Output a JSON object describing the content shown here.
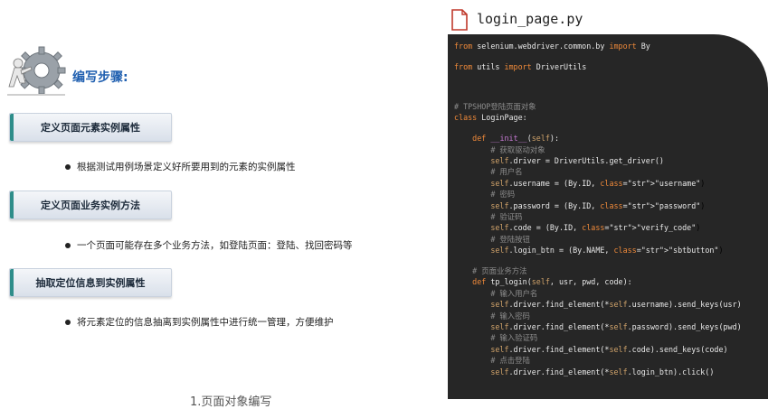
{
  "left": {
    "steps_title": "编写步骤:",
    "sections": [
      {
        "title": "定义页面元素实例属性",
        "bullet": "根据测试用例场景定义好所要用到的元素的实例属性"
      },
      {
        "title": "定义页面业务实例方法",
        "bullet": "一个页面可能存在多个业务方法，如登陆页面：登陆、找回密码等"
      },
      {
        "title": "抽取定位信息到实例属性",
        "bullet": "将元素定位的信息抽离到实例属性中进行统一管理，方便维护"
      }
    ],
    "footer_partial": "1.页面对象编写"
  },
  "file_tab": {
    "filename": "login_page.py",
    "icon": "file-icon"
  },
  "code": {
    "lines": [
      {
        "t": "from selenium.webdriver.common.by import By"
      },
      {
        "t": ""
      },
      {
        "t": "from utils import DriverUtils"
      },
      {
        "t": ""
      },
      {
        "t": ""
      },
      {
        "t": ""
      },
      {
        "t": "# TPSHOP登陆页面对象"
      },
      {
        "t": "class LoginPage:"
      },
      {
        "t": ""
      },
      {
        "t": "    def __init__(self):"
      },
      {
        "t": "        # 获取驱动对象"
      },
      {
        "t": "        self.driver = DriverUtils.get_driver()"
      },
      {
        "t": "        # 用户名"
      },
      {
        "t": "        self.username = (By.ID, \"username\")"
      },
      {
        "t": "        # 密码"
      },
      {
        "t": "        self.password = (By.ID, \"password\")"
      },
      {
        "t": "        # 验证码"
      },
      {
        "t": "        self.code = (By.ID, \"verify_code\")"
      },
      {
        "t": "        # 登陆按钮"
      },
      {
        "t": "        self.login_btn = (By.NAME, \"sbtbutton\")"
      },
      {
        "t": ""
      },
      {
        "t": "    # 页面业务方法"
      },
      {
        "t": "    def tp_login(self, usr, pwd, code):"
      },
      {
        "t": "        # 输入用户名"
      },
      {
        "t": "        self.driver.find_element(*self.username).send_keys(usr)"
      },
      {
        "t": "        # 输入密码"
      },
      {
        "t": "        self.driver.find_element(*self.password).send_keys(pwd)"
      },
      {
        "t": "        # 输入验证码"
      },
      {
        "t": "        self.driver.find_element(*self.code).send_keys(code)"
      },
      {
        "t": "        # 点击登陆"
      },
      {
        "t": "        self.driver.find_element(*self.login_btn).click()"
      }
    ]
  },
  "colors": {
    "accent": "#1f5fb0",
    "code_bg": "#262626",
    "keyword": "#f08a3a",
    "string": "#e6c25a",
    "comment": "#8c8c8c"
  }
}
